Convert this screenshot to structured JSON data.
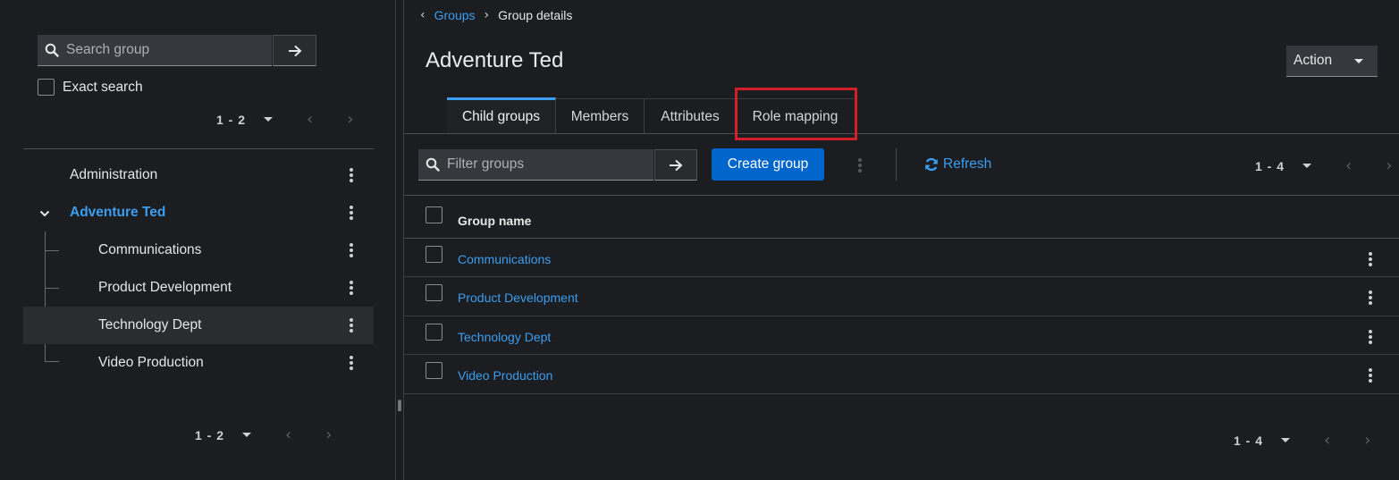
{
  "sidebar": {
    "search_placeholder": "Search group",
    "exact_search_label": "Exact search",
    "pager_top": "1 - 2",
    "pager_bottom": "1 - 2",
    "items": [
      {
        "label": "Administration"
      },
      {
        "label": "Adventure Ted",
        "expanded": true,
        "active": true
      },
      {
        "label": "Communications",
        "child": true
      },
      {
        "label": "Product Development",
        "child": true
      },
      {
        "label": "Technology Dept",
        "child": true,
        "selected": true
      },
      {
        "label": "Video Production",
        "child": true
      }
    ]
  },
  "breadcrumb": {
    "parent": "Groups",
    "current": "Group details"
  },
  "header": {
    "title": "Adventure Ted",
    "action_label": "Action"
  },
  "tabs": [
    {
      "label": "Child groups",
      "active": true
    },
    {
      "label": "Members"
    },
    {
      "label": "Attributes"
    },
    {
      "label": "Role mapping",
      "highlighted": true
    }
  ],
  "toolbar": {
    "filter_placeholder": "Filter groups",
    "create_label": "Create group",
    "refresh_label": "Refresh",
    "pager_top": "1 - 4",
    "pager_bottom": "1 - 4"
  },
  "table": {
    "column_header": "Group name",
    "rows": [
      {
        "name": "Communications"
      },
      {
        "name": "Product Development"
      },
      {
        "name": "Technology Dept"
      },
      {
        "name": "Video Production"
      }
    ]
  },
  "colors": {
    "accent": "#3b9ef0",
    "primary_button": "#0066cc",
    "highlight": "#d1202a",
    "background": "#1b1d21"
  }
}
